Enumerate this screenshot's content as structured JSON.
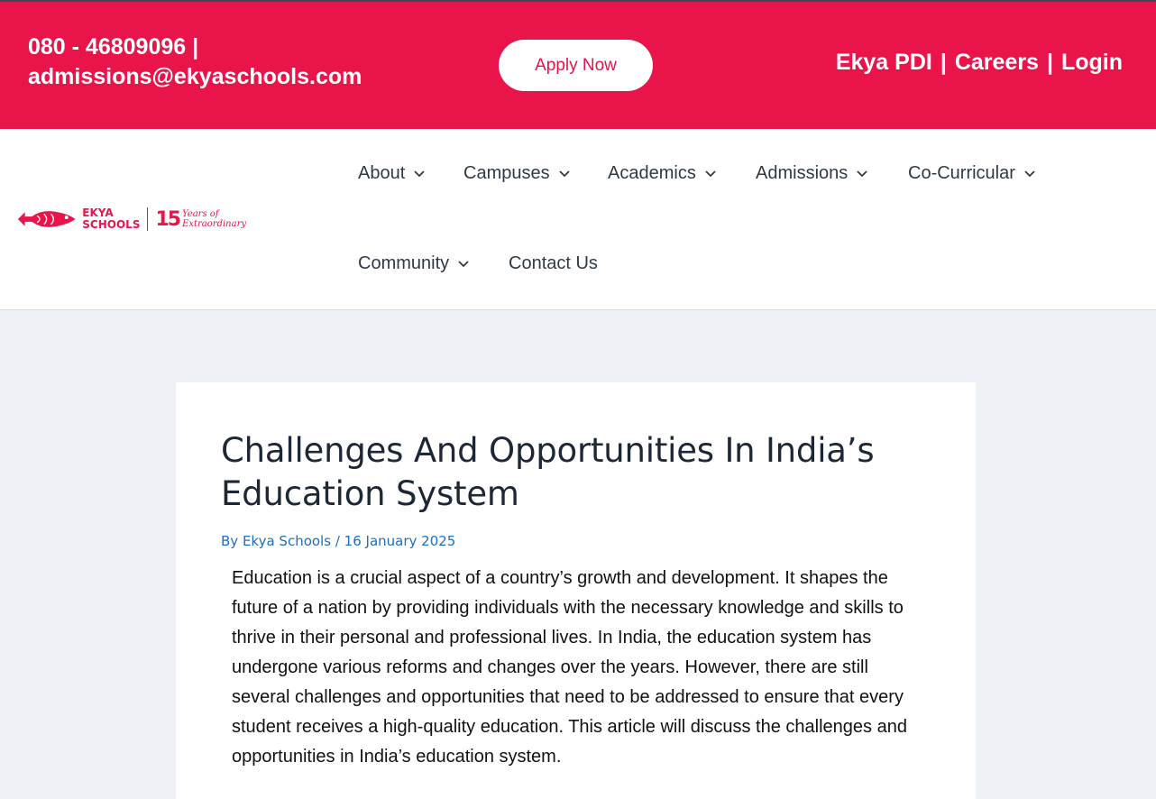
{
  "topbar": {
    "phone": "080 - 46809096 |",
    "email": "admissions@ekyaschools.com",
    "apply_label": "Apply Now",
    "links": {
      "ekya_pdi": "Ekya PDI",
      "sep1": "|",
      "careers": "Careers",
      "sep2": "|",
      "login": "Login"
    }
  },
  "logo": {
    "brand_line1": "EKYA",
    "brand_line2": "SCHOOLS",
    "anniv_number": "15",
    "anniv_line1": "Years of",
    "anniv_line2": "Extraordinary"
  },
  "nav": {
    "about": "About",
    "campuses": "Campuses",
    "academics": "Academics",
    "admissions": "Admissions",
    "co_curricular": "Co-Curricular",
    "community": "Community",
    "contact": "Contact Us"
  },
  "article": {
    "title": "Challenges And Opportunities In India’s Education System",
    "author_prefix": "By",
    "author": "Ekya Schools",
    "date_sep": "/",
    "date": "16 January 2025",
    "intro": "Education is a crucial aspect of a country’s growth and development. It shapes the future of a nation by providing individuals with the necessary knowledge and skills to thrive in their personal and professional lives. In India, the education system has undergone various reforms and changes over the years. However, there are still several challenges and opportunities that need to be addressed to ensure that every student receives a high-quality education. This article will discuss the challenges and opportunities in India’s education system."
  },
  "colors": {
    "brand_red": "#e8144a",
    "nav_text": "#2f3a45",
    "meta_blue": "#1e6fbf",
    "page_bg": "#eef2f7"
  }
}
